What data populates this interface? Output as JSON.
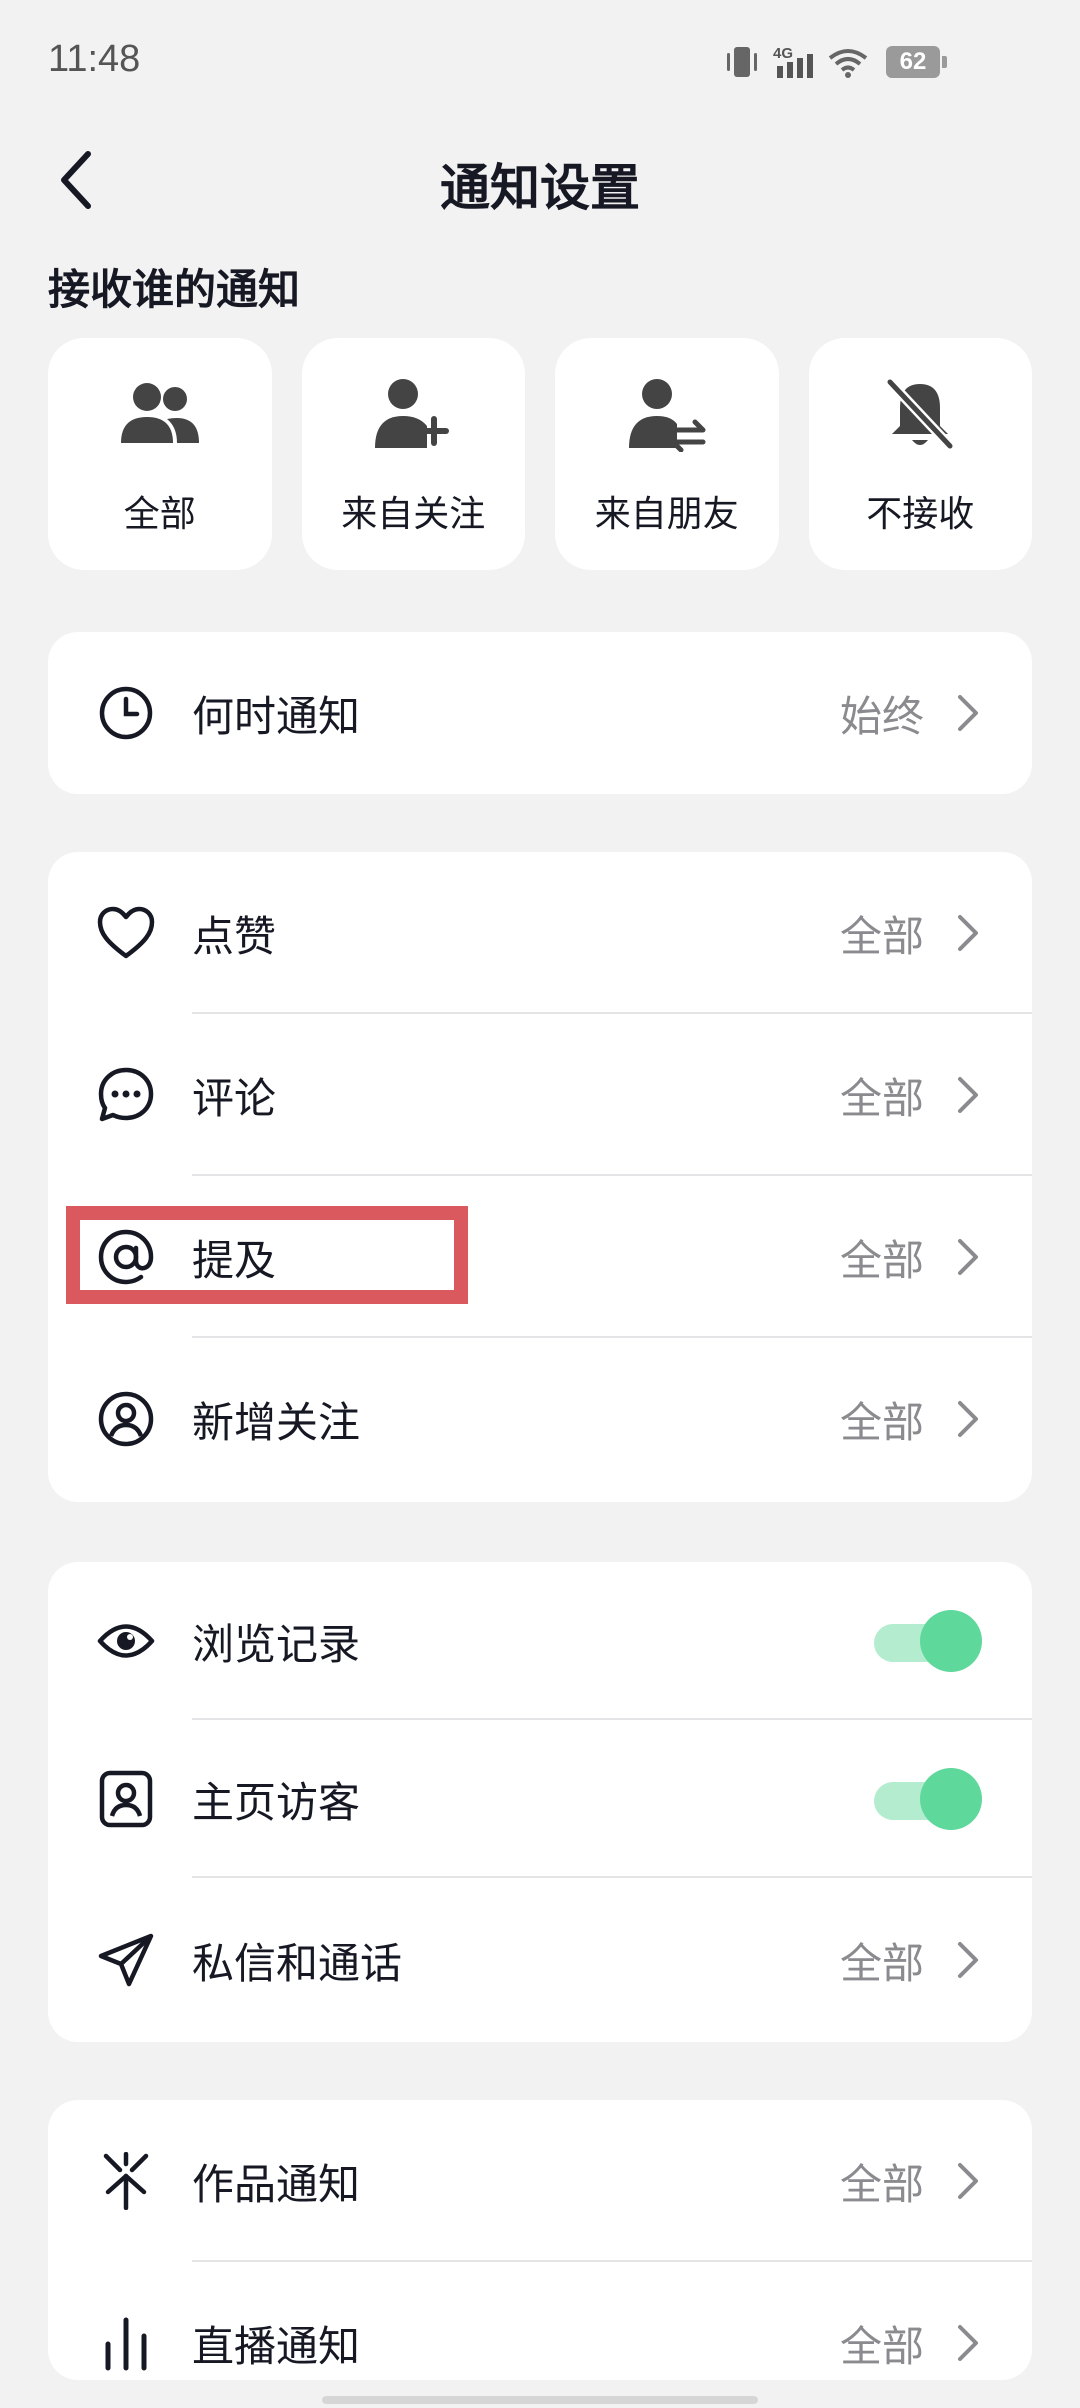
{
  "status_bar": {
    "time": "11:48",
    "battery": "62",
    "network": "4G"
  },
  "header": {
    "title": "通知设置"
  },
  "receive_section": {
    "title": "接收谁的通知",
    "options": [
      {
        "label": "全部",
        "icon": "group-icon"
      },
      {
        "label": "来自关注",
        "icon": "person-add-icon"
      },
      {
        "label": "来自朋友",
        "icon": "person-swap-icon"
      },
      {
        "label": "不接收",
        "icon": "bell-off-icon"
      }
    ]
  },
  "when_section": {
    "items": [
      {
        "label": "何时通知",
        "value": "始终",
        "icon": "clock-icon"
      }
    ]
  },
  "interaction_section": {
    "items": [
      {
        "label": "点赞",
        "value": "全部",
        "icon": "heart-icon"
      },
      {
        "label": "评论",
        "value": "全部",
        "icon": "comment-icon"
      },
      {
        "label": "提及",
        "value": "全部",
        "icon": "at-icon"
      },
      {
        "label": "新增关注",
        "value": "全部",
        "icon": "person-circle-icon"
      }
    ]
  },
  "privacy_section": {
    "items": [
      {
        "label": "浏览记录",
        "toggle_on": true,
        "icon": "eye-icon"
      },
      {
        "label": "主页访客",
        "toggle_on": true,
        "icon": "portrait-icon"
      },
      {
        "label": "私信和通话",
        "value": "全部",
        "icon": "send-icon"
      }
    ]
  },
  "content_section": {
    "items": [
      {
        "label": "作品通知",
        "value": "全部",
        "icon": "sparkle-icon"
      },
      {
        "label": "直播通知",
        "value": "全部",
        "icon": "live-bars-icon"
      }
    ]
  },
  "colors": {
    "accent_toggle": "#5fd89b",
    "highlight": "#d9595f"
  }
}
